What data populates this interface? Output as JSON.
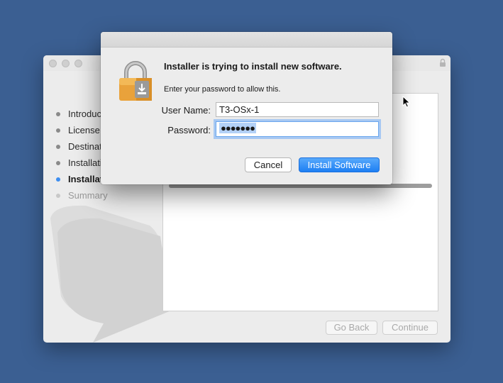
{
  "installer": {
    "steps": [
      {
        "label": "Introduc",
        "state": "done"
      },
      {
        "label": "License",
        "state": "done"
      },
      {
        "label": "Destinati",
        "state": "done"
      },
      {
        "label": "Installati",
        "state": "done"
      },
      {
        "label": "Installati",
        "state": "active"
      },
      {
        "label": "Summary",
        "state": "pending"
      }
    ],
    "go_back_label": "Go Back",
    "continue_label": "Continue"
  },
  "dialog": {
    "title": "Installer is trying to install new software.",
    "subtitle": "Enter your password to allow this.",
    "username_label": "User Name:",
    "username_value": "T3-OSx-1",
    "password_label": "Password:",
    "password_masked": "●●●●●●●",
    "cancel_label": "Cancel",
    "install_label": "Install Software"
  },
  "colors": {
    "desktop": "#3b5f92",
    "accent": "#1d7ff3",
    "active_step_dot": "#3d8ef0"
  },
  "icons": [
    "lock-icon",
    "lock-small-icon",
    "mouse-cursor-icon"
  ]
}
